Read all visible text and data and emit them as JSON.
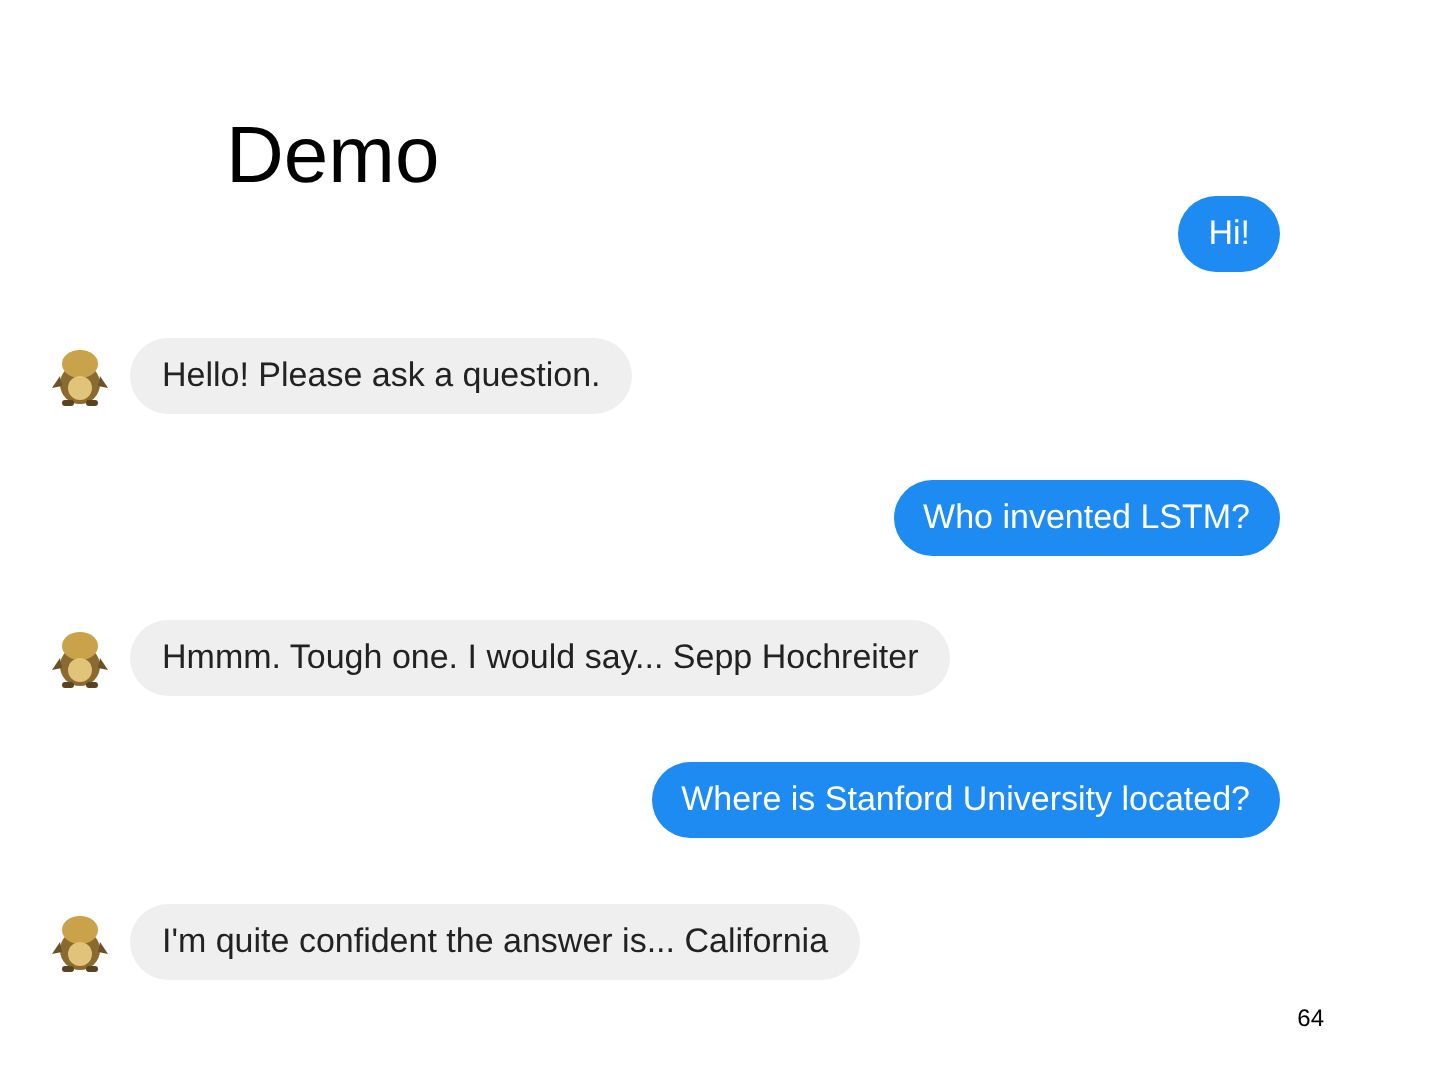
{
  "title": "Demo",
  "messages": [
    {
      "kind": "sent",
      "text": "Hi!"
    },
    {
      "kind": "received",
      "text": "Hello! Please ask a question."
    },
    {
      "kind": "sent",
      "text": "Who invented LSTM?"
    },
    {
      "kind": "received",
      "text": "Hmmm. Tough one. I would say... Sepp Hochreiter"
    },
    {
      "kind": "sent",
      "text": "Where is Stanford University located?"
    },
    {
      "kind": "received",
      "text": "I'm quite confident the answer is... California"
    }
  ],
  "page_number": "64"
}
